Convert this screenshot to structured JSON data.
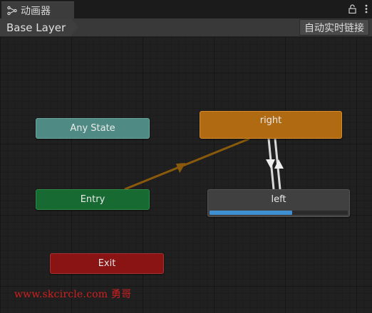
{
  "window": {
    "tab_title": "动画器",
    "tab_icon": "animator-graph-icon",
    "lock_icon": "lock-icon",
    "menu_icon": "kebab-menu-icon"
  },
  "toolbar": {
    "breadcrumb": "Base Layer",
    "live_link_button": "自动实时链接"
  },
  "graph": {
    "states": {
      "any_state": {
        "label": "Any State",
        "color": "#4f8b84"
      },
      "entry": {
        "label": "Entry",
        "color": "#176a31"
      },
      "exit": {
        "label": "Exit",
        "color": "#8a1414"
      },
      "right": {
        "label": "right",
        "color": "#b06a12",
        "is_default": true
      },
      "left": {
        "label": "left",
        "color": "#404040",
        "progress": 0.6
      }
    },
    "transitions": [
      {
        "from": "Entry",
        "to": "right",
        "color": "#8a5a0c"
      },
      {
        "from": "right",
        "to": "left",
        "color": "#d9d9d9"
      },
      {
        "from": "left",
        "to": "right",
        "color": "#d9d9d9"
      }
    ],
    "progress_color": "#3d8fd1"
  },
  "watermark": "www.skcircle.com 勇哥"
}
